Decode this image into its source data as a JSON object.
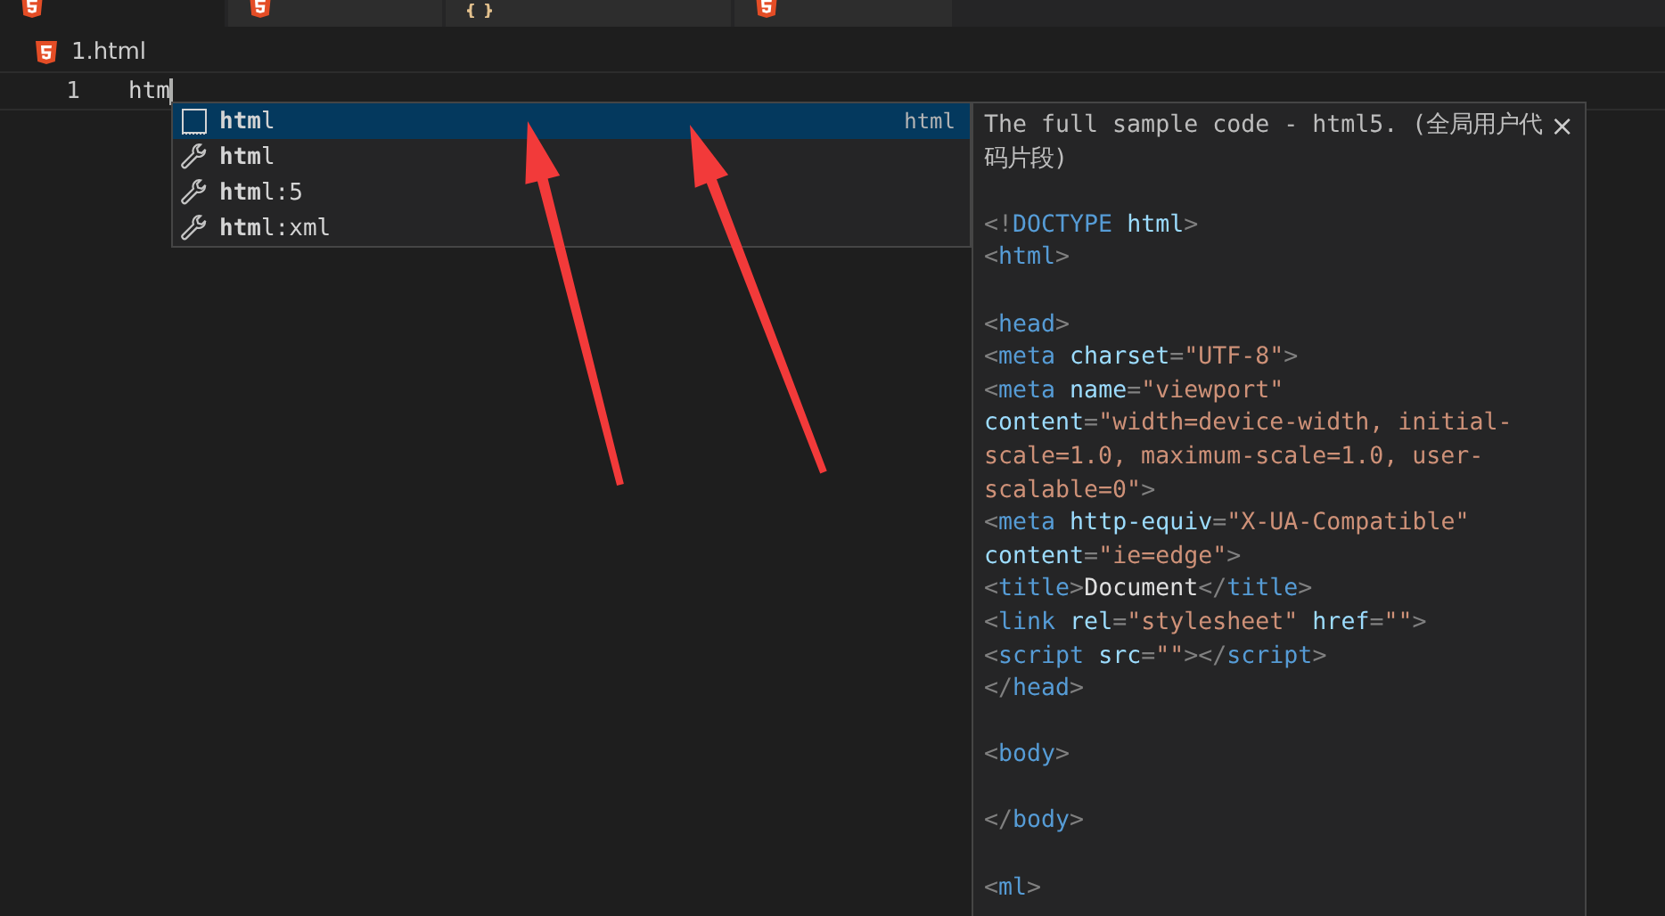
{
  "tabs": [
    {
      "kind": "html",
      "selected": true
    },
    {
      "kind": "html",
      "selected": false
    },
    {
      "kind": "braces",
      "selected": false
    },
    {
      "kind": "html",
      "selected": false
    }
  ],
  "breadcrumb": {
    "file": "1.html"
  },
  "editor": {
    "lines": [
      {
        "number": "1",
        "text": "htm"
      }
    ]
  },
  "suggest": {
    "items": [
      {
        "kind": "snippet",
        "label": "**htm**l",
        "detail": "html",
        "selected": true
      },
      {
        "kind": "wrench",
        "label": "**htm**l",
        "selected": false
      },
      {
        "kind": "wrench",
        "label": "**htm**l:5",
        "selected": false
      },
      {
        "kind": "wrench",
        "label": "**htm**l:xml",
        "selected": false
      }
    ]
  },
  "details": {
    "title": "The full sample code - html5. (全局用户代码片段)",
    "close": "×",
    "lines": [
      {
        "kind": "blank"
      },
      {
        "kind": "code",
        "tokens": [
          {
            "kind": "punct",
            "text": "<!"
          },
          {
            "kind": "tag",
            "text": "DOCTYPE"
          },
          {
            "kind": "attr",
            "text": " html"
          },
          {
            "kind": "punct",
            "text": ">"
          }
        ]
      },
      {
        "kind": "code",
        "tokens": [
          {
            "kind": "punct",
            "text": "<"
          },
          {
            "kind": "tag",
            "text": "html"
          },
          {
            "kind": "punct",
            "text": ">"
          }
        ]
      },
      {
        "kind": "blank"
      },
      {
        "kind": "code",
        "tokens": [
          {
            "kind": "punct",
            "text": "<"
          },
          {
            "kind": "tag",
            "text": "head"
          },
          {
            "kind": "punct",
            "text": ">"
          }
        ]
      },
      {
        "kind": "code",
        "tokens": [
          {
            "kind": "punct",
            "text": "<"
          },
          {
            "kind": "tag",
            "text": "meta"
          },
          {
            "kind": "attr",
            "text": " charset"
          },
          {
            "kind": "punct",
            "text": "="
          },
          {
            "kind": "string",
            "text": "\"UTF-8\""
          },
          {
            "kind": "punct",
            "text": ">"
          }
        ]
      },
      {
        "kind": "code",
        "tokens": [
          {
            "kind": "punct",
            "text": "<"
          },
          {
            "kind": "tag",
            "text": "meta"
          },
          {
            "kind": "attr",
            "text": " name"
          },
          {
            "kind": "punct",
            "text": "="
          },
          {
            "kind": "string",
            "text": "\"viewport\""
          }
        ]
      },
      {
        "kind": "code",
        "tokens": [
          {
            "kind": "attr",
            "text": "content"
          },
          {
            "kind": "punct",
            "text": "="
          },
          {
            "kind": "string",
            "text": "\"width=device-width, initial-"
          }
        ]
      },
      {
        "kind": "code",
        "tokens": [
          {
            "kind": "string",
            "text": "scale=1.0, maximum-scale=1.0, user-"
          }
        ]
      },
      {
        "kind": "code",
        "tokens": [
          {
            "kind": "string",
            "text": "scalable=0\""
          },
          {
            "kind": "punct",
            "text": ">"
          }
        ]
      },
      {
        "kind": "code",
        "tokens": [
          {
            "kind": "punct",
            "text": "<"
          },
          {
            "kind": "tag",
            "text": "meta"
          },
          {
            "kind": "attr",
            "text": " http-equiv"
          },
          {
            "kind": "punct",
            "text": "="
          },
          {
            "kind": "string",
            "text": "\"X-UA-Compatible\""
          }
        ]
      },
      {
        "kind": "code",
        "tokens": [
          {
            "kind": "attr",
            "text": "content"
          },
          {
            "kind": "punct",
            "text": "="
          },
          {
            "kind": "string",
            "text": "\"ie=edge\""
          },
          {
            "kind": "punct",
            "text": ">"
          }
        ]
      },
      {
        "kind": "code",
        "tokens": [
          {
            "kind": "punct",
            "text": "<"
          },
          {
            "kind": "tag",
            "text": "title"
          },
          {
            "kind": "punct",
            "text": ">"
          },
          {
            "kind": "text",
            "text": "Document"
          },
          {
            "kind": "punct",
            "text": "</"
          },
          {
            "kind": "tag",
            "text": "title"
          },
          {
            "kind": "punct",
            "text": ">"
          }
        ]
      },
      {
        "kind": "code",
        "tokens": [
          {
            "kind": "punct",
            "text": "<"
          },
          {
            "kind": "tag",
            "text": "link"
          },
          {
            "kind": "attr",
            "text": " rel"
          },
          {
            "kind": "punct",
            "text": "="
          },
          {
            "kind": "string",
            "text": "\"stylesheet\""
          },
          {
            "kind": "attr",
            "text": " href"
          },
          {
            "kind": "punct",
            "text": "="
          },
          {
            "kind": "string",
            "text": "\"\""
          },
          {
            "kind": "punct",
            "text": ">"
          }
        ]
      },
      {
        "kind": "code",
        "tokens": [
          {
            "kind": "punct",
            "text": "<"
          },
          {
            "kind": "tag",
            "text": "script"
          },
          {
            "kind": "attr",
            "text": " src"
          },
          {
            "kind": "punct",
            "text": "="
          },
          {
            "kind": "string",
            "text": "\"\""
          },
          {
            "kind": "punct",
            "text": "></"
          },
          {
            "kind": "tag",
            "text": "script"
          },
          {
            "kind": "punct",
            "text": ">"
          }
        ]
      },
      {
        "kind": "code",
        "tokens": [
          {
            "kind": "punct",
            "text": "</"
          },
          {
            "kind": "tag",
            "text": "head"
          },
          {
            "kind": "punct",
            "text": ">"
          }
        ]
      },
      {
        "kind": "blank"
      },
      {
        "kind": "code",
        "tokens": [
          {
            "kind": "punct",
            "text": "<"
          },
          {
            "kind": "tag",
            "text": "body"
          },
          {
            "kind": "punct",
            "text": ">"
          }
        ]
      },
      {
        "kind": "blank"
      },
      {
        "kind": "code",
        "tokens": [
          {
            "kind": "punct",
            "text": "</"
          },
          {
            "kind": "tag",
            "text": "body"
          },
          {
            "kind": "punct",
            "text": ">"
          }
        ]
      },
      {
        "kind": "blank"
      },
      {
        "kind": "code",
        "tokens": [
          {
            "kind": "punct",
            "text": "<"
          },
          {
            "kind": "tag",
            "text": "ml"
          },
          {
            "kind": "punct",
            "text": ">"
          }
        ]
      }
    ]
  },
  "annotations": [
    {
      "kind": "arrow"
    },
    {
      "kind": "arrow"
    }
  ]
}
